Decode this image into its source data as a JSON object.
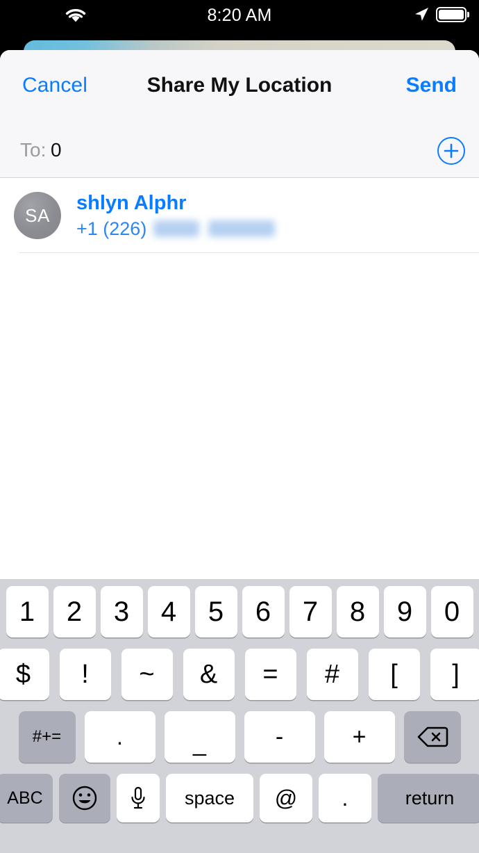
{
  "status_bar": {
    "time": "8:20 AM",
    "wifi_icon": "wifi-icon",
    "location_icon": "location-arrow-icon",
    "battery_icon": "battery-full-icon"
  },
  "nav": {
    "cancel_label": "Cancel",
    "title": "Share My Location",
    "send_label": "Send"
  },
  "recipient_field": {
    "to_label": "To:",
    "value": "0",
    "add_contact_icon": "plus-circle-icon"
  },
  "results": {
    "contacts": [
      {
        "initials": "SA",
        "name": "shlyn Alphr",
        "phone_prefix": "+1 (226)",
        "phone_redacted": true
      }
    ]
  },
  "keyboard": {
    "type": "numeric-symbols",
    "row1": [
      "1",
      "2",
      "3",
      "4",
      "5",
      "6",
      "7",
      "8",
      "9",
      "0"
    ],
    "row2": [
      "$",
      "!",
      "~",
      "&",
      "=",
      "#",
      "[",
      "]"
    ],
    "row3": {
      "shift_label": "#+=",
      "keys": [
        ".",
        "_",
        "-",
        "+"
      ],
      "delete_icon": "backspace-delete-icon"
    },
    "row4": {
      "abc_label": "ABC",
      "emoji_icon": "smiley-emoji-icon",
      "mic_icon": "microphone-icon",
      "space_label": "space",
      "at_label": "@",
      "period_label": ".",
      "return_label": "return"
    }
  },
  "colors": {
    "accent_blue": "#0a7cff",
    "keyboard_bg": "#d1d3d9",
    "key_white": "#ffffff",
    "key_dark": "#abaeb9",
    "header_bg": "#f7f7f9",
    "avatar_gray": "#8c8c93"
  }
}
